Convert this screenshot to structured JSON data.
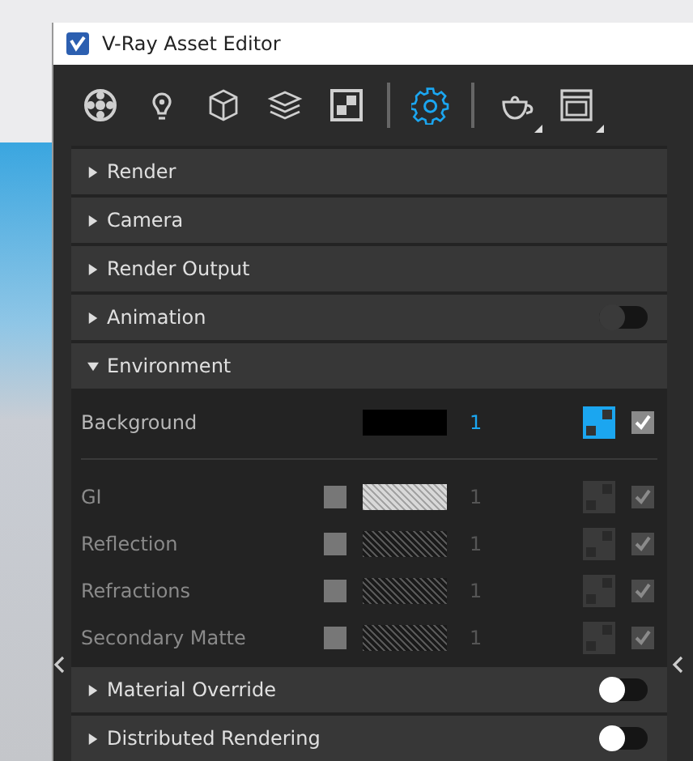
{
  "window": {
    "title": "V-Ray Asset Editor"
  },
  "toolbar": [
    {
      "selected": false
    },
    {
      "selected": false
    },
    {
      "selected": false
    },
    {
      "selected": false
    },
    {
      "selected": false
    },
    {
      "selected": true
    },
    {
      "selected": false
    },
    {
      "selected": false
    }
  ],
  "sections": [
    {
      "label": "Render",
      "expanded": false
    },
    {
      "label": "Camera",
      "expanded": false
    },
    {
      "label": "Render Output",
      "expanded": false
    },
    {
      "label": "Animation",
      "expanded": false,
      "toggle": {
        "on": false,
        "disabled": true
      }
    },
    {
      "label": "Environment",
      "expanded": true,
      "rows": [
        {
          "kind": "background",
          "label": "Background",
          "disabled": false,
          "color": "#000000",
          "hatched": false,
          "value": "1",
          "texture_on": true,
          "checked": true
        },
        {
          "kind": "separator"
        },
        {
          "label": "GI",
          "kind": "channel",
          "disabled": true,
          "override": false,
          "color": "#d8d8d8",
          "hatched": true,
          "value": "1",
          "texture_on": false,
          "checked": true
        },
        {
          "label": "Reflection",
          "kind": "channel",
          "disabled": true,
          "override": false,
          "color": "#1a1a1a",
          "hatched": true,
          "value": "1",
          "texture_on": false,
          "checked": true
        },
        {
          "label": "Refractions",
          "kind": "channel",
          "disabled": true,
          "override": false,
          "color": "#1a1a1a",
          "hatched": true,
          "value": "1",
          "texture_on": false,
          "checked": true
        },
        {
          "label": "Secondary Matte",
          "kind": "channel",
          "disabled": true,
          "override": false,
          "color": "#1a1a1a",
          "hatched": true,
          "value": "1",
          "texture_on": false,
          "checked": true
        }
      ]
    },
    {
      "label": "Material Override",
      "expanded": false,
      "toggle": {
        "on": false,
        "disabled": false
      }
    },
    {
      "label": "Distributed Rendering",
      "expanded": false,
      "toggle": {
        "on": false,
        "disabled": false
      }
    }
  ]
}
